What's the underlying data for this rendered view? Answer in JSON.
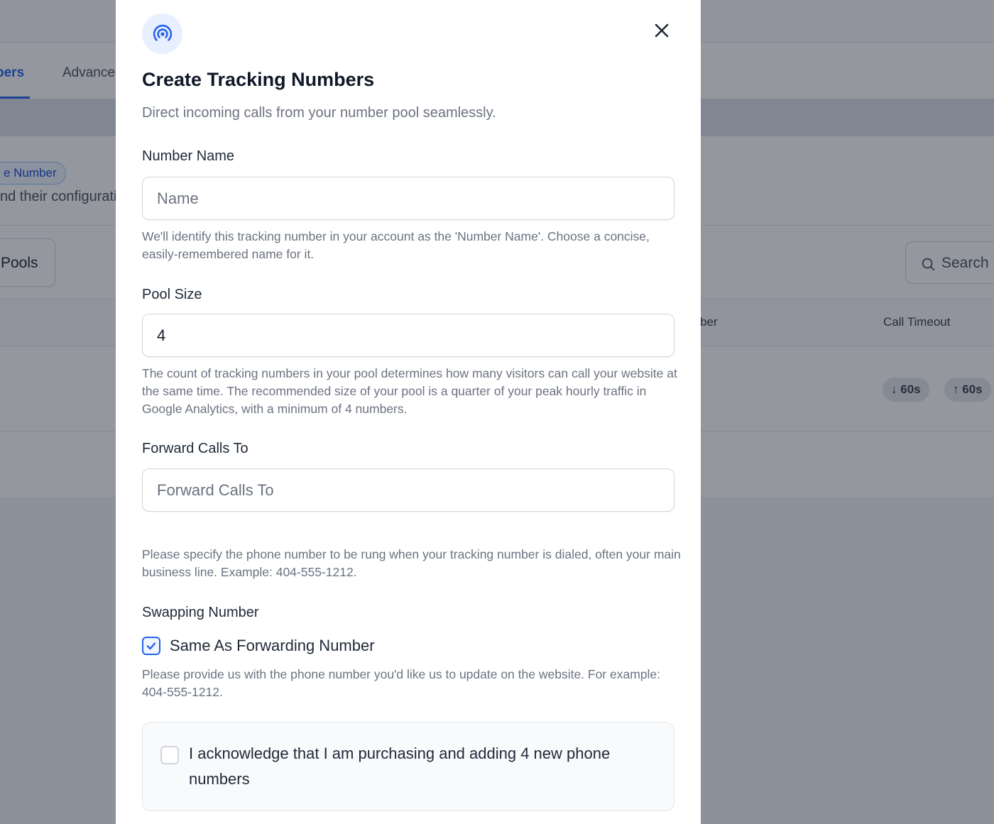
{
  "background": {
    "tabs": [
      "bers",
      "Advanced"
    ],
    "badge": "e Number",
    "description": "nd their configuration",
    "pools_button": "Pools",
    "search_label": "Search",
    "table_headers": [
      "ber",
      "Call Timeout"
    ],
    "timeouts": [
      "60s",
      "60s"
    ]
  },
  "modal": {
    "title": "Create Tracking Numbers",
    "subtitle": "Direct incoming calls from your number pool seamlessly.",
    "icon": "signal-broadcast-icon",
    "accent_color": "#2563eb",
    "number_name": {
      "label": "Number Name",
      "placeholder": "Name",
      "value": "",
      "help": "We'll identify this tracking number in your account as the 'Number Name'. Choose a concise, easily-remembered name for it."
    },
    "pool_size": {
      "label": "Pool Size",
      "value": "4",
      "help": "The count of tracking numbers in your pool determines how many visitors can call your website at the same time. The recommended size of your pool is a quarter of your peak hourly traffic in Google Analytics, with a minimum of 4 numbers."
    },
    "forward_calls": {
      "label": "Forward Calls To",
      "placeholder": "Forward Calls To",
      "value": "",
      "help": "Please specify the phone number to be rung when your tracking number is dialed, often your main business line. Example: 404-555-1212."
    },
    "swapping": {
      "label": "Swapping Number",
      "checkbox_label": "Same As Forwarding Number",
      "checked": true,
      "help": "Please provide us with the phone number you'd like us to update on the website. For example: 404-555-1212."
    },
    "acknowledge": {
      "text": "I acknowledge that I am purchasing and adding 4 new phone numbers",
      "checked": false
    }
  }
}
